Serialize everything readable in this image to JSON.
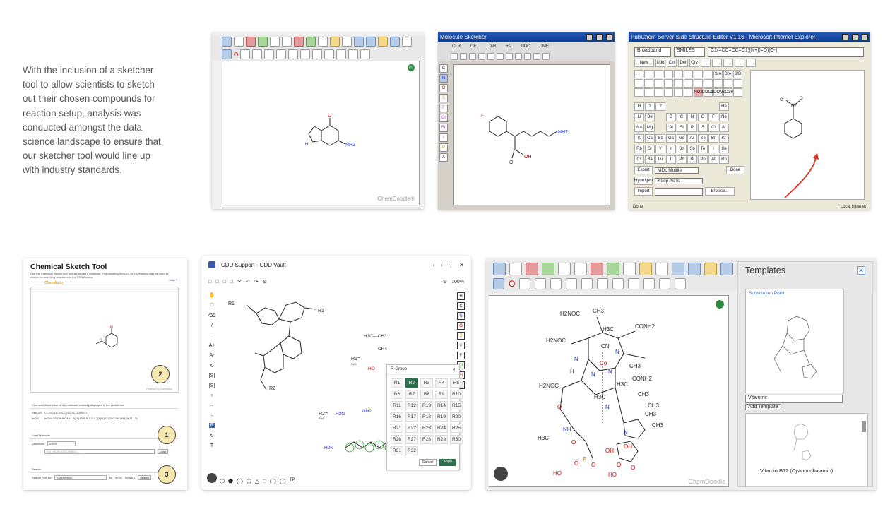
{
  "intro": {
    "text": "With the inclusion of a sketcher tool to allow scientists to sketch out their chosen compounds for reaction setup, analysis was conducted amongst the data science landscape to ensure that our sketcher tool would line up with industry standards."
  },
  "chemdoodle": {
    "watermark": "ChemDoodle®",
    "atom_o": "O",
    "atom_n": "N",
    "atom_nh2": "NH2",
    "atom_h": "H",
    "zoom_badge": "(0)"
  },
  "jme": {
    "title": "Molecule Sketcher",
    "toolbar": [
      "CLR",
      "DEL",
      "D-R",
      "+/-",
      "UDO",
      "JME"
    ],
    "side_atoms": [
      "C",
      "N",
      "O",
      "S",
      "F",
      "Cl",
      "Br",
      "I",
      "P",
      "X"
    ],
    "atom_f": "F",
    "atom_oh": "OH",
    "atom_o": "O",
    "atom_nh2": "NH2"
  },
  "pubchem": {
    "title": "PubChem Server Side Structure Editor V1.16 - Microsoft Internet Explorer",
    "mode": "Broadband",
    "format": "SMILES",
    "smiles": "C1(=CC=CC=C1)[N+](=O)[O-]",
    "buttons": [
      "New",
      "Udo",
      "Cln",
      "Del",
      "Qry"
    ],
    "elements": [
      [
        "H",
        "?",
        "?",
        "",
        "",
        "",
        "",
        "",
        "He"
      ],
      [
        "Li",
        "Be",
        "",
        "B",
        "C",
        "N",
        "O",
        "F",
        "Ne"
      ],
      [
        "Na",
        "Mg",
        "",
        "Al",
        "Si",
        "P",
        "S",
        "Cl",
        "Ar"
      ],
      [
        "K",
        "Ca",
        "Sc",
        "Ga",
        "Ge",
        "As",
        "Se",
        "Br",
        "Kr"
      ],
      [
        "Rb",
        "Sr",
        "Y",
        "In",
        "Sn",
        "Sb",
        "Te",
        "I",
        "Xe"
      ],
      [
        "Cs",
        "Ba",
        "Lu",
        "Tl",
        "Pb",
        "Bi",
        "Po",
        "At",
        "Rn"
      ]
    ],
    "groups": [
      "S/A",
      "D/A",
      "S/D",
      "NO2",
      "COOH",
      "COOMe",
      "SO3H"
    ],
    "export_label": "Export",
    "export_format": "MDL Molfile",
    "done": "Done",
    "hydrogen_label": "Hydrogen",
    "hydrogen_value": "Keep As Is",
    "import_label": "Import",
    "browse": "Browse...",
    "status": "Done",
    "zone": "Local intranet",
    "atom_o_minus": "O-",
    "atom_n_plus": "N+",
    "atom_o": "O"
  },
  "sketch": {
    "title": "Chemical Sketch Tool",
    "subtitle": "Use the Chemical Sketch tool to draw or edit a molecule. The resulting SMILES or InChI string may be used to search for matching structures in the PDB Archive.",
    "help": "Help ?",
    "brand": "ChemAxon",
    "powered": "Powered by ChemAxon",
    "desc_header": "Chemical description of the molecule currently displayed in the sketch tool",
    "smiles_label": "SMILES",
    "smiles_value": "CC(=O)OC1=CC=CC=C1C(O)=O",
    "inchi_label": "InChI",
    "inchi_value": "InChI=1S/C9H8O4/c1-6(10)13-8-5-3-2-4-7(8)9(11)12/h2-5H,1H3,(H,11,12)",
    "load_header": "Load Molecule",
    "descriptor_label": "Descriptor",
    "descriptor_value": "InChI",
    "load_placeholder": "e.g., InChI=1S/C4H8/c1-...",
    "load_btn": "Load",
    "search_header": "Search",
    "search_label": "Search PDB for",
    "search_value": "Exact match",
    "by": "by",
    "opt_inchi": "InChI",
    "opt_smiles": "SMILES",
    "search_btn": "Search",
    "badges": [
      "2",
      "1",
      "3"
    ],
    "atom_ho": "HO",
    "atom_o": "O"
  },
  "cdd": {
    "title": "CDD Support - CDD Vault",
    "zoom": "100%",
    "right_atoms": [
      "H",
      "C",
      "N",
      "O",
      "S",
      "P",
      "F",
      "Cl",
      "Br",
      "I"
    ],
    "r1": "R1",
    "r2": "R2",
    "r1_def": "R1=",
    "r1_sub": "R1r0",
    "ch3": "H3C—CH3",
    "ch4": "CH4",
    "ho": "HO",
    "r2_def": "R2=",
    "r2_sub": "R2r0",
    "h2n": "H2N",
    "nh2": "NH2",
    "rgroup_title": "R-Group",
    "rgroups": [
      "R1",
      "R2",
      "R3",
      "R4",
      "R5",
      "R6",
      "R7",
      "R8",
      "R9",
      "R10",
      "R11",
      "R12",
      "R13",
      "R14",
      "R15",
      "R16",
      "R17",
      "R18",
      "R19",
      "R20",
      "R21",
      "R22",
      "R23",
      "R24",
      "R25",
      "R26",
      "R27",
      "R28",
      "R29",
      "R30",
      "R31",
      "R32"
    ],
    "selected": "R2",
    "cancel": "Cancel",
    "apply": "Apply",
    "left_tools": [
      "[S]",
      "[S]"
    ],
    "bottom_tp": "TP"
  },
  "cd_big": {
    "templates_title": "Templates",
    "substitution": "Substitution Point",
    "category": "Vitamins",
    "add_template": "Add Template",
    "template_name": "Vitamin B12 (Cyanocobalamin)",
    "watermark": "ChemDoodle",
    "labels": [
      "H2NOC",
      "CH3",
      "H3C",
      "CONH2",
      "H2NOC",
      "CN",
      "N",
      "N",
      "Co",
      "N",
      "N",
      "CH3",
      "H3C",
      "H3C",
      "H2NOC",
      "H",
      "CH3",
      "CH3",
      "CONH2",
      "O",
      "NH",
      "N",
      "CH3",
      "H3C",
      "O",
      "N",
      "CH3",
      "O",
      "P",
      "O",
      "OH",
      "HO",
      "O",
      "HO",
      "OH",
      "O"
    ]
  }
}
